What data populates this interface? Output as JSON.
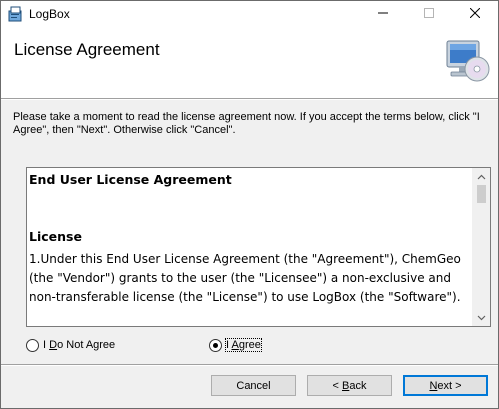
{
  "window": {
    "title": "LogBox",
    "controls": {
      "minimize": "minimize",
      "maximize": "maximize",
      "close": "close"
    }
  },
  "header": {
    "title": "License Agreement",
    "graphic": "computer-cd-icon"
  },
  "instructions": "Please take a moment to read the license agreement now. If you accept the terms below, click \"I Agree\", then \"Next\". Otherwise click \"Cancel\".",
  "license": {
    "heading": "End User License Agreement",
    "section": "License",
    "paragraph": "1.Under this End User License Agreement (the \"Agreement\"), ChemGeo (the \"Vendor\") grants to the user (the \"Licensee\") a non-exclusive and non-transferable license (the \"License\") to use LogBox (the \"Software\")."
  },
  "options": {
    "disagree_prefix": "I ",
    "disagree_key": "D",
    "disagree_suffix": "o Not Agree",
    "agree_prefix": "I ",
    "agree_key": "A",
    "agree_suffix": "gree",
    "selected": "agree"
  },
  "buttons": {
    "cancel": "Cancel",
    "back_prefix": "< ",
    "back_key": "B",
    "back_suffix": "ack",
    "next_key": "N",
    "next_suffix": "ext >"
  },
  "colors": {
    "accent": "#0078d7",
    "background": "#f0f0f0"
  }
}
